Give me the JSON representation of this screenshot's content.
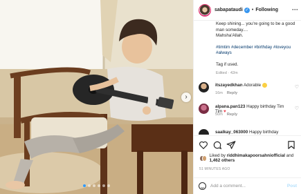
{
  "header": {
    "username": "sabapataudi",
    "separator": "•",
    "follow_label": "Following",
    "more_icon": "more-horizontal-icon"
  },
  "caption": {
    "line1": "Keep shining... you're going to be a good man someday....\nMahsha'Allah.",
    "hashtags": "#timtim #december #birthday #loveyou #always",
    "tag_line": "Tag if used.",
    "meta": "Edited · 42m"
  },
  "comments": [
    {
      "user": "itszayedkhan",
      "text": "Adorable",
      "emoji": "smiling-face",
      "time": "16m",
      "reply": "Reply"
    },
    {
      "user": "alpana.pan123",
      "text": "Happy birthday Tim Tim",
      "emoji": "red-heart",
      "time": "50m",
      "reply": "Reply"
    },
    {
      "user": "saalkay_063000",
      "text": "Happy birthday",
      "time": "",
      "reply": ""
    }
  ],
  "likes": {
    "prefix": "Liked by",
    "user": "riddhimakapoorsahniofficial",
    "and": "and",
    "others": "1,462 others"
  },
  "timestamp": "51 MINUTES AGO",
  "add_comment": {
    "placeholder": "Add a comment...",
    "post_label": "Post"
  },
  "carousel": {
    "slide_count": 6,
    "active_index": 0
  },
  "colors": {
    "verified": "#3897f0",
    "hashtag": "#00376b",
    "post_disabled": "#b2dffc",
    "heart": "#ed4956"
  }
}
